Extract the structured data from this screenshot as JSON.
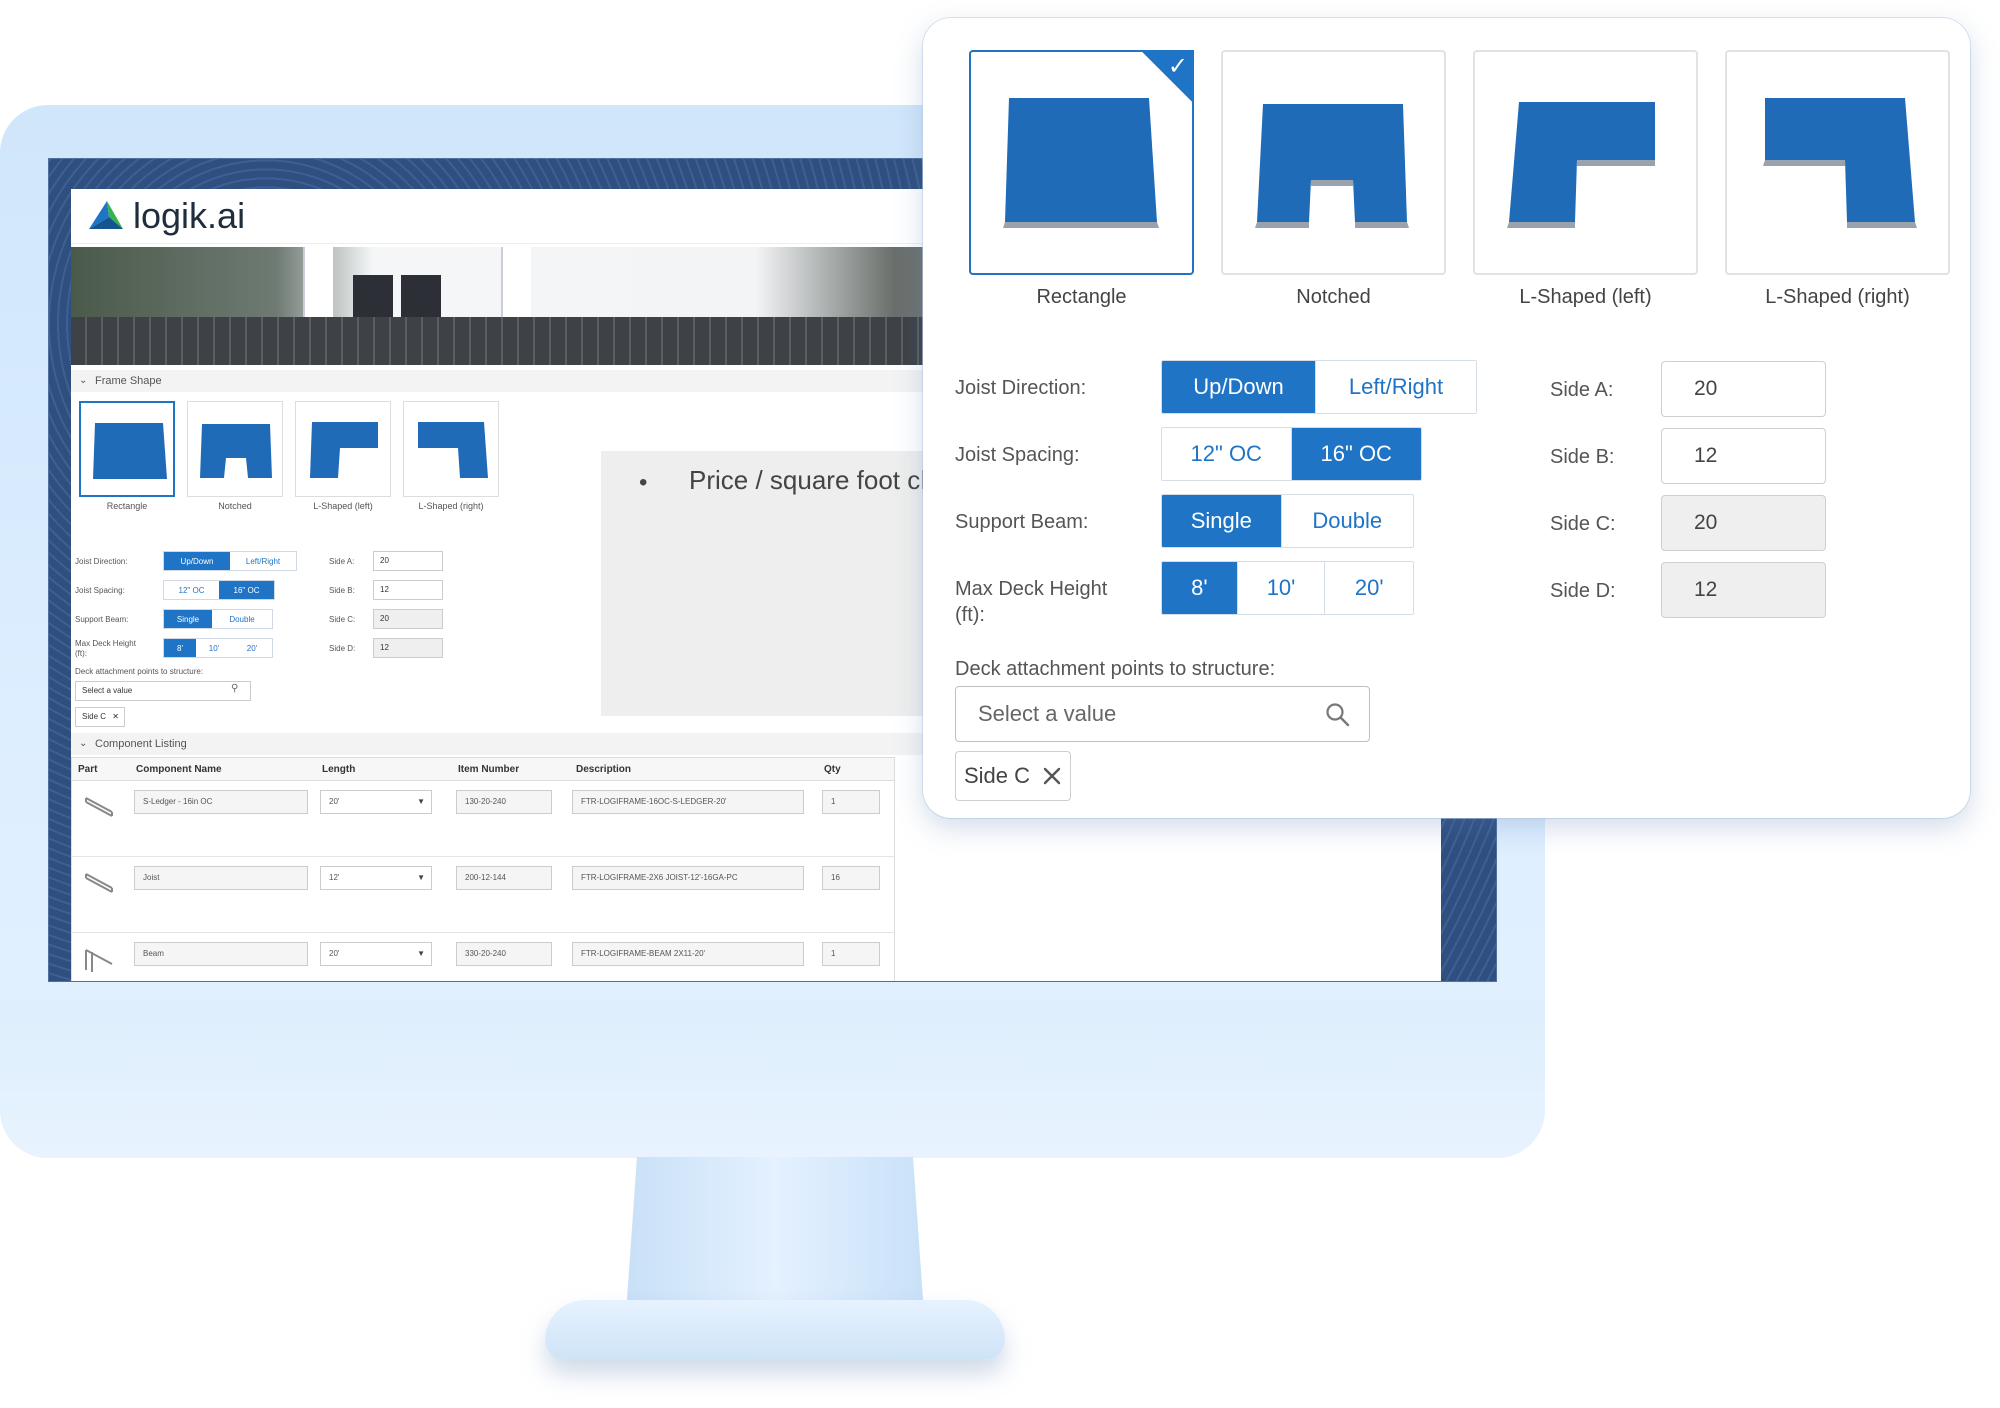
{
  "brand": {
    "logo_text": "logik.ai",
    "accent": "#1f74c6"
  },
  "screen": {
    "frame_shape": {
      "section_title": "Frame Shape",
      "shapes": [
        "Rectangle",
        "Notched",
        "L-Shaped (left)",
        "L-Shaped (right)"
      ],
      "joist_direction": {
        "label": "Joist Direction:",
        "options": [
          "Up/Down",
          "Left/Right"
        ]
      },
      "joist_spacing": {
        "label": "Joist Spacing:",
        "options": [
          "12\" OC",
          "16\" OC"
        ]
      },
      "support_beam": {
        "label": "Support Beam:",
        "options": [
          "Single",
          "Double"
        ]
      },
      "max_height": {
        "label_line1": "Max Deck Height",
        "label_line2": "(ft):",
        "options": [
          "8'",
          "10'",
          "20'"
        ]
      },
      "sides": [
        {
          "label": "Side A:",
          "value": "20"
        },
        {
          "label": "Side B:",
          "value": "12"
        },
        {
          "label": "Side C:",
          "value": "20"
        },
        {
          "label": "Side D:",
          "value": "12"
        }
      ],
      "attachment_label": "Deck attachment points to structure:",
      "search_placeholder": "Select a value",
      "chip": "Side C"
    },
    "price_note": {
      "bullet": "•",
      "text": "Price / square foot changes with each selection"
    },
    "component_listing": {
      "section_title": "Component Listing",
      "columns": [
        "Part",
        "Component Name",
        "Length",
        "Item Number",
        "Description",
        "Qty"
      ],
      "rows": [
        {
          "name": "S-Ledger - 16in OC",
          "length": "20'",
          "item": "130-20-240",
          "description": "FTR-LOGIFRAME-16OC-S-LEDGER-20'",
          "qty": "1"
        },
        {
          "name": "Joist",
          "length": "12'",
          "item": "200-12-144",
          "description": "FTR-LOGIFRAME-2X6 JOIST-12'-16GA-PC",
          "qty": "16"
        },
        {
          "name": "Beam",
          "length": "20'",
          "item": "330-20-240",
          "description": "FTR-LOGIFRAME-BEAM 2X11-20'",
          "qty": "1"
        }
      ]
    }
  },
  "panel": {
    "shapes": [
      {
        "label": "Rectangle",
        "selected": true
      },
      {
        "label": "Notched",
        "selected": false
      },
      {
        "label": "L-Shaped (left)",
        "selected": false
      },
      {
        "label": "L-Shaped (right)",
        "selected": false
      }
    ],
    "joist_direction": {
      "label": "Joist Direction:",
      "options": [
        "Up/Down",
        "Left/Right"
      ],
      "selected": "Up/Down"
    },
    "joist_spacing": {
      "label": "Joist Spacing:",
      "options": [
        "12\" OC",
        "16\" OC"
      ],
      "selected": "16\" OC"
    },
    "support_beam": {
      "label": "Support Beam:",
      "options": [
        "Single",
        "Double"
      ],
      "selected": "Single"
    },
    "max_height": {
      "label_line1": "Max Deck Height",
      "label_line2": "(ft):",
      "options": [
        "8'",
        "10'",
        "20'"
      ],
      "selected": "8'"
    },
    "sides": [
      {
        "label": "Side A:",
        "value": "20",
        "readonly": false
      },
      {
        "label": "Side B:",
        "value": "12",
        "readonly": false
      },
      {
        "label": "Side C:",
        "value": "20",
        "readonly": true
      },
      {
        "label": "Side D:",
        "value": "12",
        "readonly": true
      }
    ],
    "attachment_label": "Deck attachment points to structure:",
    "search_placeholder": "Select a value",
    "chip": "Side C"
  },
  "icons": {
    "search": "search-icon",
    "close": "close-icon",
    "check": "check-icon",
    "chevron": "chevron-down-icon"
  }
}
